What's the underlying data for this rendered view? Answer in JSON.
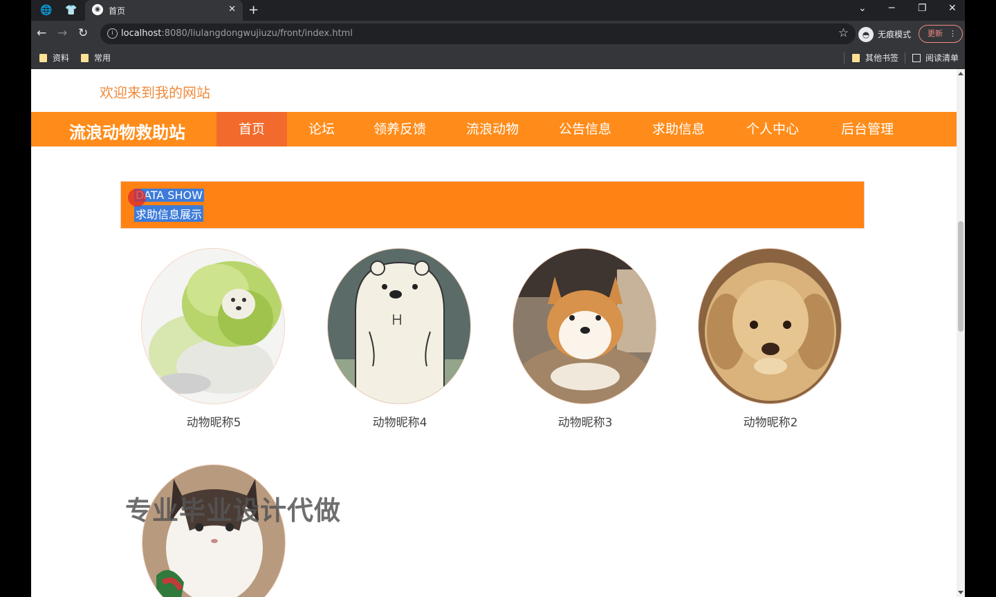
{
  "browser": {
    "tab_title": "首页",
    "url_host": "localhost",
    "url_rest": ":8080/liulangdongwujiuzu/front/index.html",
    "incognito_label": "无痕模式",
    "update_label": "更新",
    "bookmarks": [
      {
        "label": "资料"
      },
      {
        "label": "常用"
      }
    ],
    "other_bookmarks_label": "其他书签",
    "reading_list_label": "阅读清单"
  },
  "site": {
    "welcome": "欢迎来到我的网站",
    "brand": "流浪动物救助站",
    "nav": [
      {
        "label": "首页",
        "active": true
      },
      {
        "label": "论坛",
        "active": false
      },
      {
        "label": "领养反馈",
        "active": false
      },
      {
        "label": "流浪动物",
        "active": false
      },
      {
        "label": "公告信息",
        "active": false
      },
      {
        "label": "求助信息",
        "active": false
      },
      {
        "label": "个人中心",
        "active": false
      },
      {
        "label": "后台管理",
        "active": false
      }
    ],
    "accent_color": "#ff8c1a"
  },
  "section": {
    "title_en": "DATA SHOW",
    "title_zh": "求助信息展示"
  },
  "animals": [
    {
      "name": "动物昵称5",
      "image": "cabbage-dog"
    },
    {
      "name": "动物昵称4",
      "image": "cartoon-bear"
    },
    {
      "name": "动物昵称3",
      "image": "shiba-dog"
    },
    {
      "name": "动物昵称2",
      "image": "golden-puppy"
    },
    {
      "name": "",
      "image": "cat"
    }
  ],
  "watermark": "专业毕业设计代做"
}
